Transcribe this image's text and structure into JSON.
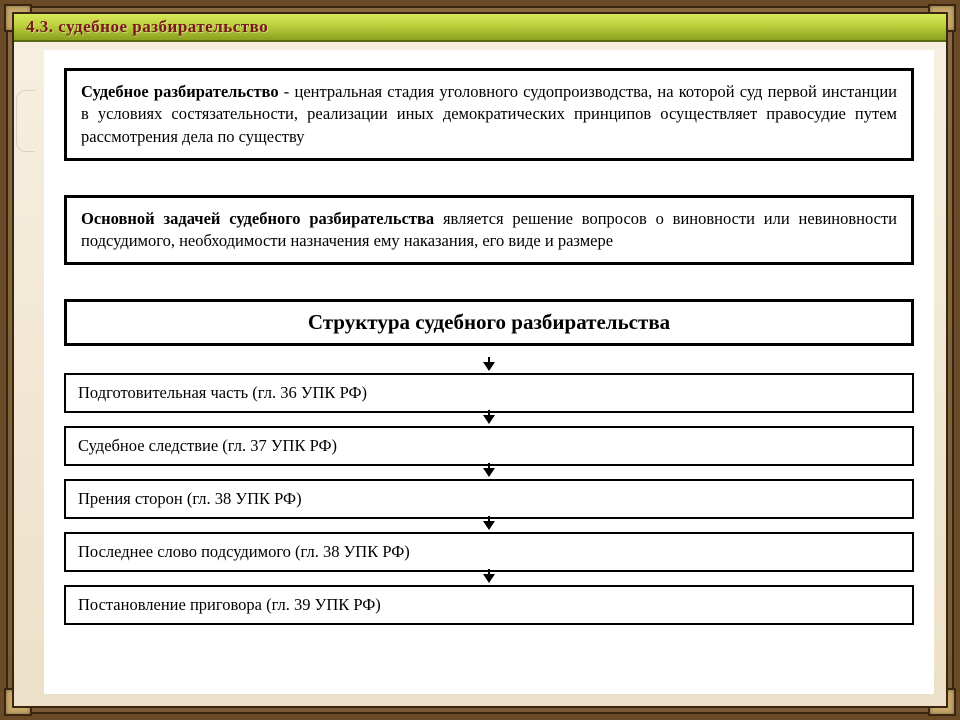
{
  "header": {
    "title": "4.3. судебное разбирательство"
  },
  "definition": {
    "lead": "Судебное разбирательство",
    "dash": " - ",
    "body": "центральная стадия уголовного судопроизводства, на которой суд первой инстанции в условиях состязательности, реализации иных демократических принципов осуществляет правосудие путем рассмотрения дела по существу"
  },
  "task": {
    "lead": "Основной задачей судебного разбирательства",
    "body": " является решение вопросов о виновности или невиновности подсудимого, необходимости назначения ему наказания, его виде и размере"
  },
  "structure": {
    "title": "Структура судебного разбирательства",
    "steps": [
      "Подготовительная часть (гл. 36 УПК РФ)",
      "Судебное следствие (гл. 37 УПК РФ)",
      "Прения сторон (гл. 38 УПК РФ)",
      "Последнее слово подсудимого (гл. 38 УПК РФ)",
      "Постановление приговора (гл. 39 УПК РФ)"
    ]
  }
}
